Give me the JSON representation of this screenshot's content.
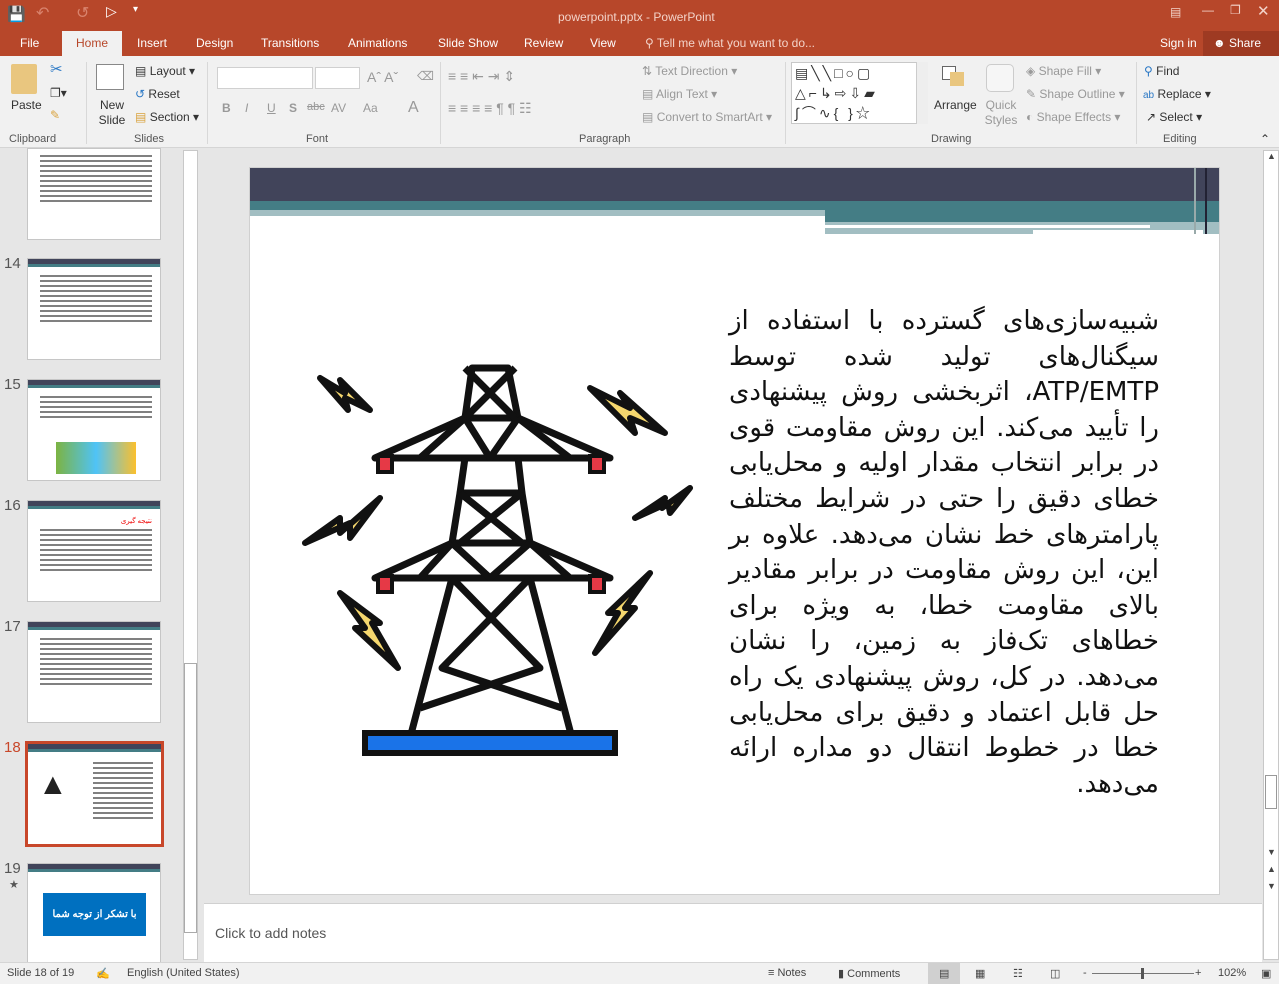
{
  "titlebar": {
    "title": "powerpoint.pptx - PowerPoint",
    "quick_access": [
      "save-icon",
      "undo-icon",
      "redo-icon",
      "start-from-beginning-icon",
      "customize-icon"
    ]
  },
  "tabs": [
    {
      "label": "File"
    },
    {
      "label": "Home",
      "active": true
    },
    {
      "label": "Insert"
    },
    {
      "label": "Design"
    },
    {
      "label": "Transitions"
    },
    {
      "label": "Animations"
    },
    {
      "label": "Slide Show"
    },
    {
      "label": "Review"
    },
    {
      "label": "View"
    }
  ],
  "tell_me": "Tell me what you want to do...",
  "sign_in": "Sign in",
  "share": "Share",
  "ribbon": {
    "clipboard": {
      "paste": "Paste",
      "group": "Clipboard"
    },
    "slides": {
      "new_slide": "New Slide",
      "layout": "Layout",
      "reset": "Reset",
      "section": "Section",
      "group": "Slides"
    },
    "font": {
      "group": "Font",
      "bold": "B",
      "italic": "I",
      "underline": "U",
      "shadow": "S",
      "strike": "abc",
      "spacing": "AV",
      "case": "Aa",
      "color": "A"
    },
    "paragraph": {
      "text_direction": "Text Direction",
      "align_text": "Align Text",
      "smartart": "Convert to SmartArt",
      "group": "Paragraph"
    },
    "drawing": {
      "arrange": "Arrange",
      "quick_styles": "Quick Styles",
      "shape_fill": "Shape Fill",
      "shape_outline": "Shape Outline",
      "shape_effects": "Shape Effects",
      "group": "Drawing"
    },
    "editing": {
      "find": "Find",
      "replace": "Replace",
      "select": "Select",
      "group": "Editing"
    }
  },
  "thumbnails": [
    {
      "number": "14"
    },
    {
      "number": "15"
    },
    {
      "number": "16",
      "title": "نتیجه گیری"
    },
    {
      "number": "17"
    },
    {
      "number": "18",
      "selected": true
    },
    {
      "number": "19",
      "button": "با تشکر از توجه شما"
    }
  ],
  "slide": {
    "body": "شبیه‌سازی‌های گسترده با استفاده از سیگنال‌های تولید شده توسط ATP/EMTP، اثربخشی روش پیشنهادی را تأیید می‌کند. این روش مقاومت قوی در برابر انتخاب مقدار اولیه و محل‌یابی خطای دقیق را حتی در شرایط مختلف پارامترهای خط نشان می‌دهد. علاوه بر این، این روش مقاومت در برابر مقادیر بالای مقاومت خطا، به ویژه برای خطاهای تک‌فاز به زمین، را نشان می‌دهد. در کل، روش پیشنهادی یک راه حل قابل اعتماد و دقیق برای محل‌یابی خطا در خطوط انتقال دو مداره ارائه می‌دهد.",
    "image": "transmission-tower-lightning-icon"
  },
  "notes_placeholder": "Click to add notes",
  "status": {
    "slide": "Slide 18 of 19",
    "language": "English (United States)",
    "notes": "Notes",
    "comments": "Comments",
    "zoom": "102%",
    "zoom_value": 102
  },
  "colors": {
    "accent": "#b7472a",
    "header_dark": "#41445a",
    "header_teal": "#447d85",
    "header_light": "#a2bec2",
    "tower_base": "#1a73e8",
    "bolt": "#f5d76e",
    "tower_red": "#e63946"
  }
}
